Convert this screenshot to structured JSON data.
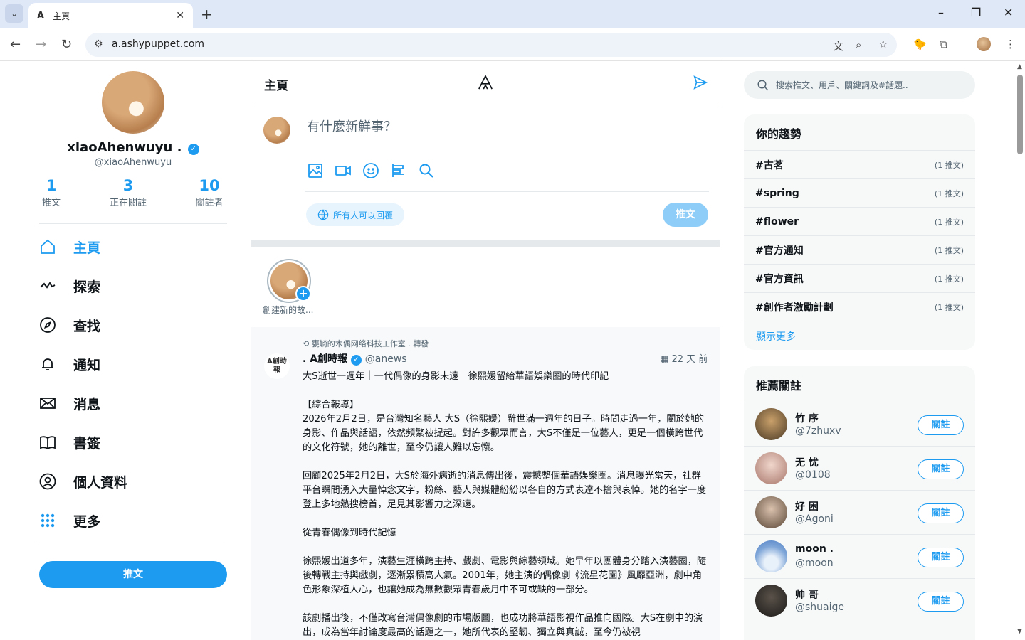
{
  "browser": {
    "tab_title": "主頁",
    "tab_favicon": "A",
    "url": "a.ashypuppet.com",
    "window_controls": [
      "minimize-icon",
      "maximize-icon",
      "close-icon"
    ]
  },
  "profile": {
    "name": "xiaoAhenwuyu .",
    "handle": "@xiaoAhenwuyu",
    "stats": [
      {
        "value": "1",
        "label": "推文"
      },
      {
        "value": "3",
        "label": "正在關註"
      },
      {
        "value": "10",
        "label": "關註者"
      }
    ]
  },
  "nav": {
    "items": [
      {
        "label": "主頁",
        "icon": "home-icon",
        "active": true
      },
      {
        "label": "探索",
        "icon": "pulse-icon"
      },
      {
        "label": "查找",
        "icon": "compass-icon"
      },
      {
        "label": "通知",
        "icon": "bell-icon"
      },
      {
        "label": "消息",
        "icon": "mail-icon"
      },
      {
        "label": "書簽",
        "icon": "book-icon"
      },
      {
        "label": "個人資料",
        "icon": "user-circle-icon"
      },
      {
        "label": "更多",
        "icon": "grid-dots-icon"
      }
    ],
    "tweet_button": "推文"
  },
  "main": {
    "title": "主頁",
    "composer": {
      "placeholder": "有什麽新鮮事？",
      "reply_setting": "所有人可以回覆",
      "post_button": "推文"
    },
    "stories": {
      "create_label": "創建新的故..."
    },
    "post": {
      "repost_line": "甕觭的木偶网络科技工作室 . 轉發",
      "author": ". A創時報",
      "handle": "@anews",
      "avatar_text": "A創時報",
      "time": "22 天 前",
      "headline": "大S逝世一週年｜一代偶像的身影未遠　徐熙媛留給華語娛樂圈的時代印記",
      "paragraphs": [
        "【綜合報導】\n2026年2月2日，是台灣知名藝人 大S（徐熙媛）辭世滿一週年的日子。時間走過一年，關於她的身影、作品與話語，依然頻繁被提起。對許多觀眾而言，大S不僅是一位藝人，更是一個橫跨世代的文化符號，她的離世，至今仍讓人難以忘懷。",
        "回顧2025年2月2日，大S於海外病逝的消息傳出後，震撼整個華語娛樂圈。消息曝光當天，社群平台瞬間湧入大量悼念文字，粉絲、藝人與媒體紛紛以各自的方式表達不捨與哀悼。她的名字一度登上多地熱搜榜首，足見其影響力之深遠。",
        "從青春偶像到時代記憶",
        "徐熙媛出道多年，演藝生涯橫跨主持、戲劇、電影與綜藝領域。她早年以團體身分踏入演藝圈，隨後轉戰主持與戲劇，逐漸累積高人氣。2001年，她主演的偶像劇《流星花園》風靡亞洲，劇中角色形象深植人心，也讓她成為無數觀眾青春歲月中不可或缺的一部分。",
        "該劇播出後，不僅改寫台灣偶像劇的市場版圖，也成功將華語影視作品推向國際。大S在劇中的演出，成為當年討論度最高的話題之一，她所代表的堅韌、獨立與真誠，至今仍被視"
      ]
    }
  },
  "right": {
    "search_placeholder": "搜索推文、用戶、關鍵詞及#話題..",
    "trends": {
      "title": "你的趨勢",
      "items": [
        {
          "tag": "#古茗",
          "count": "(1 推文)"
        },
        {
          "tag": "#spring",
          "count": "(1 推文)"
        },
        {
          "tag": "#flower",
          "count": "(1 推文)"
        },
        {
          "tag": "#官方通知",
          "count": "(1 推文)"
        },
        {
          "tag": "#官方資訊",
          "count": "(1 推文)"
        },
        {
          "tag": "#創作者激勵計劃",
          "count": "(1 推文)"
        }
      ],
      "show_more": "顯示更多"
    },
    "recommend": {
      "title": "推薦關註",
      "items": [
        {
          "name": "竹 序",
          "handle": "@7zhuxv",
          "button": "關註",
          "color": "#6d5a3e"
        },
        {
          "name": "无 忧",
          "handle": "@0108",
          "button": "關註",
          "color": "#c9a89a"
        },
        {
          "name": "好 困",
          "handle": "@Agoni",
          "button": "關註",
          "color": "#8b7362"
        },
        {
          "name": "moon .",
          "handle": "@moon",
          "button": "關註",
          "color": "#7fa6d8"
        },
        {
          "name": "帅 哥",
          "handle": "@shuaige",
          "button": "關註",
          "color": "#2c2a28"
        }
      ]
    }
  },
  "colors": {
    "accent": "#1d9bf0",
    "accent_light": "#8ecdf8",
    "text": "#0f1419",
    "muted": "#536471"
  }
}
